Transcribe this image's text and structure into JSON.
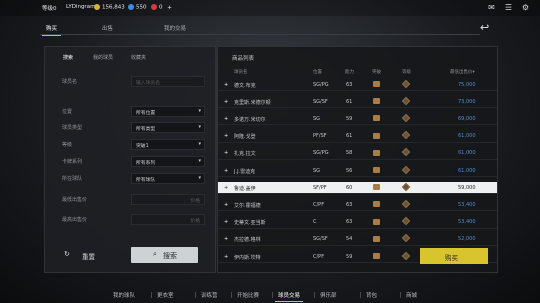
{
  "topbar": {
    "player_level": "等级0",
    "username": "LYDingram",
    "gold": "156,843",
    "diamonds": "550",
    "tickets": "0",
    "add_symbol": "+",
    "icons": [
      "chat-icon",
      "mail-icon",
      "settings-icon"
    ]
  },
  "main_tabs": [
    {
      "label": "购买",
      "active": true
    },
    {
      "label": "出售",
      "active": false
    },
    {
      "label": "我的交易",
      "active": false
    }
  ],
  "filters": {
    "sub_tabs": [
      {
        "label": "搜索",
        "active": true
      },
      {
        "label": "我的球员",
        "active": false
      },
      {
        "label": "收藏夹",
        "active": false
      }
    ],
    "player_name_label": "球员名",
    "player_name_placeholder": "输入球员名",
    "position_label": "位置",
    "position_value": "所有位置",
    "player_type_label": "球员类型",
    "player_type_value": "所有类型",
    "grade_label": "等级",
    "grade_value": "突破1",
    "card_series_label": "卡牌系列",
    "card_series_value": "所有系列",
    "team_label": "所在球队",
    "team_value": "所有球队",
    "min_price_label": "最低出售价",
    "max_price_label": "最高出售价",
    "price_unit": "价格",
    "reset_label": "重置",
    "search_label": "搜索"
  },
  "market": {
    "title": "商品列表",
    "columns": [
      "球员名",
      "位置",
      "能力",
      "突破",
      "等级",
      "最低出售价"
    ],
    "sort_arrow": "▾",
    "rows": [
      {
        "name": "德文.布克",
        "pos": "SG/PG",
        "ovr": "63",
        "price": "75,000",
        "selected": false
      },
      {
        "name": "克里斯.米德尔顿",
        "pos": "SG/SF",
        "ovr": "61",
        "price": "73,000",
        "selected": false
      },
      {
        "name": "多诺万.米切尔",
        "pos": "SG",
        "ovr": "59",
        "price": "69,000",
        "selected": false
      },
      {
        "name": "阿隆.戈登",
        "pos": "PF/SF",
        "ovr": "61",
        "price": "61,000",
        "selected": false
      },
      {
        "name": "扎克.拉文",
        "pos": "SG/PG",
        "ovr": "58",
        "price": "61,000",
        "selected": false
      },
      {
        "name": "J.J.雷迪克",
        "pos": "SG",
        "ovr": "56",
        "price": "61,000",
        "selected": false
      },
      {
        "name": "鲁迪.盖伊",
        "pos": "SF/PF",
        "ovr": "60",
        "price": "59,000",
        "selected": true
      },
      {
        "name": "艾尔.霍福德",
        "pos": "C/PF",
        "ovr": "63",
        "price": "53,400",
        "selected": false
      },
      {
        "name": "史蒂文.亚当斯",
        "pos": "C",
        "ovr": "63",
        "price": "53,400",
        "selected": false
      },
      {
        "name": "杰拉德.格林",
        "pos": "SG/SF",
        "ovr": "54",
        "price": "52,000",
        "selected": false
      },
      {
        "name": "伊内斯.坎特",
        "pos": "C/PF",
        "ovr": "59",
        "price": "51,000",
        "selected": false
      }
    ],
    "plus_marker": "+",
    "buy_label": "购买"
  },
  "bottom_nav": [
    {
      "label": "我的球队",
      "active": false
    },
    {
      "label": "更衣室",
      "active": false
    },
    {
      "label": "训练营",
      "active": false
    },
    {
      "label": "开始比赛",
      "active": false
    },
    {
      "label": "球员交易",
      "active": true
    },
    {
      "label": "俱乐部",
      "active": false
    },
    {
      "label": "背包",
      "active": false
    },
    {
      "label": "商城",
      "active": false
    }
  ]
}
